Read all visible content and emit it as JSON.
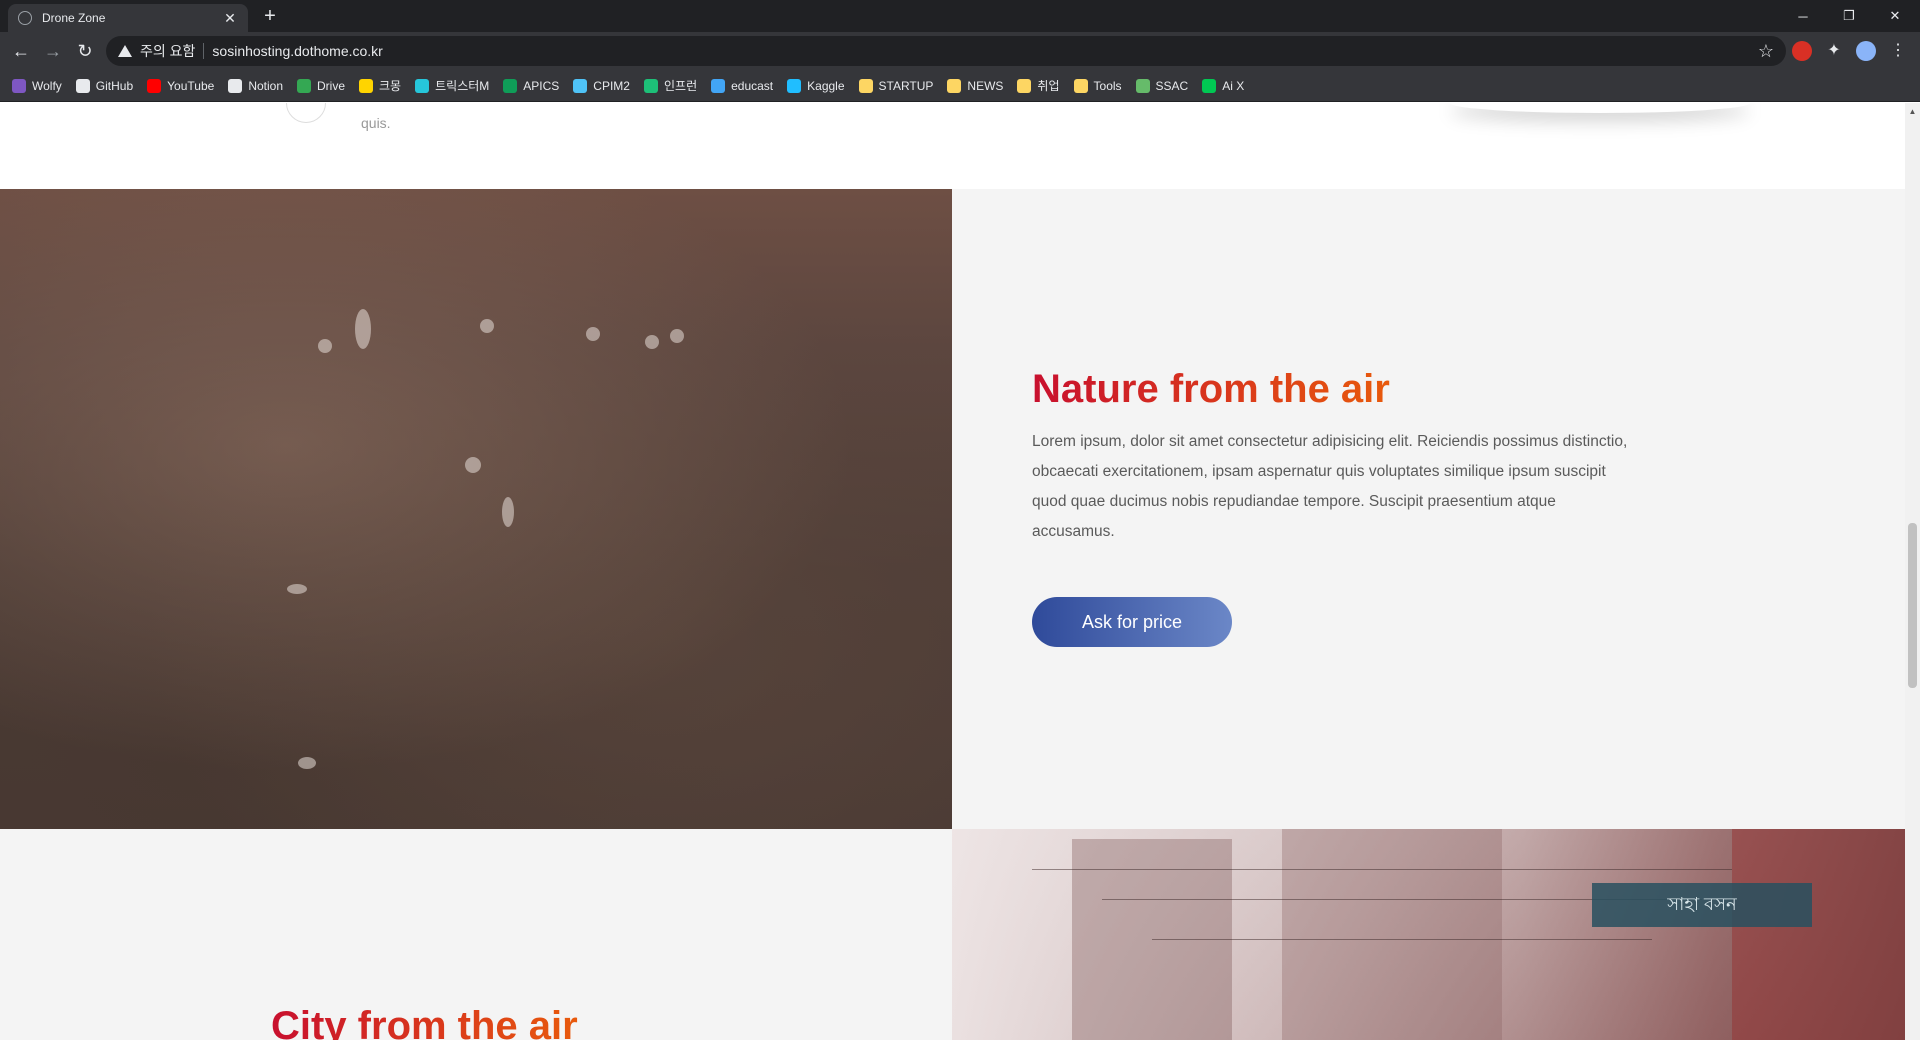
{
  "browser": {
    "tab_title": "Drone Zone",
    "tab_close": "✕",
    "new_tab": "+",
    "window_controls": {
      "minimize": "─",
      "restore": "❐",
      "close": "✕"
    },
    "nav": {
      "back": "←",
      "forward": "→",
      "reload": "↻"
    },
    "security_label": "주의 요함",
    "url": "sosinhosting.dothome.co.kr",
    "star": "☆"
  },
  "bookmarks": [
    {
      "label": "Wolfy",
      "icon": "wolfy-icon",
      "color": "#7e57c2"
    },
    {
      "label": "GitHub",
      "icon": "github-icon",
      "color": "#e8eaed"
    },
    {
      "label": "YouTube",
      "icon": "youtube-icon",
      "color": "#ff0000"
    },
    {
      "label": "Notion",
      "icon": "notion-icon",
      "color": "#e8eaed"
    },
    {
      "label": "Drive",
      "icon": "drive-icon",
      "color": "#34a853"
    },
    {
      "label": "크몽",
      "icon": "kmong-icon",
      "color": "#ffd400"
    },
    {
      "label": "트릭스터M",
      "icon": "trickster-icon",
      "color": "#26c6da"
    },
    {
      "label": "APICS",
      "icon": "apics-icon",
      "color": "#0f9d58"
    },
    {
      "label": "CPIM2",
      "icon": "cpim-icon",
      "color": "#4fc3f7"
    },
    {
      "label": "인프런",
      "icon": "inflearn-icon",
      "color": "#1dc078"
    },
    {
      "label": "educast",
      "icon": "educast-icon",
      "color": "#42a5f5"
    },
    {
      "label": "Kaggle",
      "icon": "kaggle-icon",
      "color": "#20beff"
    },
    {
      "label": "STARTUP",
      "icon": "folder-icon",
      "color": "#fdd663"
    },
    {
      "label": "NEWS",
      "icon": "folder-icon",
      "color": "#fdd663"
    },
    {
      "label": "취업",
      "icon": "folder-icon",
      "color": "#fdd663"
    },
    {
      "label": "Tools",
      "icon": "folder-icon",
      "color": "#fdd663"
    },
    {
      "label": "SSAC",
      "icon": "ssac-icon",
      "color": "#66bb6a"
    },
    {
      "label": "Ai X",
      "icon": "aix-icon",
      "color": "#00c853"
    }
  ],
  "page": {
    "top_strip": {
      "text": "quis."
    },
    "nature": {
      "title": "Nature from the air",
      "description": "Lorem ipsum, dolor sit amet consectetur adipisicing elit. Reiciendis possimus distinctio, obcaecati exercitationem, ipsam aspernatur quis voluptates similique ipsum suscipit quod quae ducimus nobis repudiandae tempore. Suscipit praesentium atque accusamus.",
      "button": "Ask for price"
    },
    "city": {
      "title": "City from the air",
      "sign_text": "সাহা বসন"
    }
  },
  "colors": {
    "title_gradient_start": "#c8102e",
    "title_gradient_end": "#e85a0c",
    "button_gradient_start": "#2f4a9a",
    "button_gradient_end": "#6b87c7"
  }
}
